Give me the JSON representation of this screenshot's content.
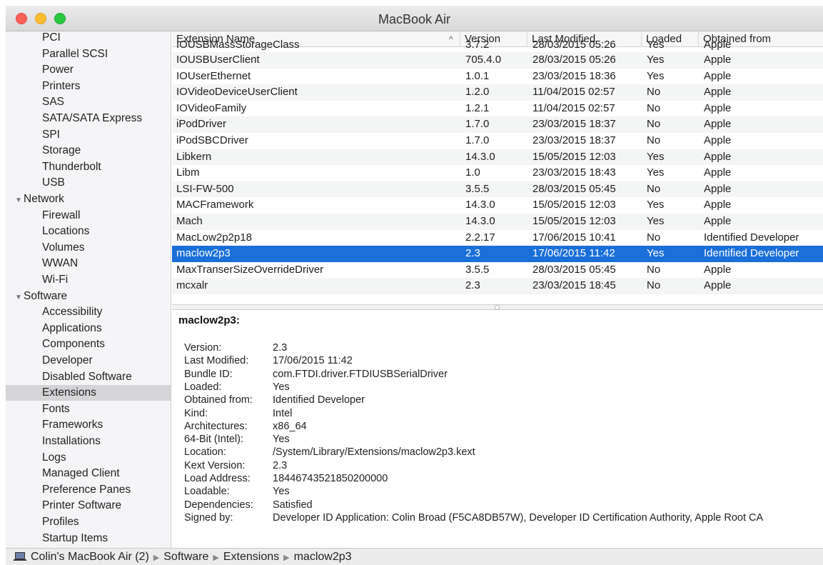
{
  "window": {
    "title": "MacBook Air"
  },
  "sidebar": {
    "items": [
      {
        "label": "PCI",
        "type": "child"
      },
      {
        "label": "Parallel SCSI",
        "type": "child"
      },
      {
        "label": "Power",
        "type": "child"
      },
      {
        "label": "Printers",
        "type": "child"
      },
      {
        "label": "SAS",
        "type": "child"
      },
      {
        "label": "SATA/SATA Express",
        "type": "child"
      },
      {
        "label": "SPI",
        "type": "child"
      },
      {
        "label": "Storage",
        "type": "child"
      },
      {
        "label": "Thunderbolt",
        "type": "child"
      },
      {
        "label": "USB",
        "type": "child"
      },
      {
        "label": "Network",
        "type": "section"
      },
      {
        "label": "Firewall",
        "type": "child"
      },
      {
        "label": "Locations",
        "type": "child"
      },
      {
        "label": "Volumes",
        "type": "child"
      },
      {
        "label": "WWAN",
        "type": "child"
      },
      {
        "label": "Wi-Fi",
        "type": "child"
      },
      {
        "label": "Software",
        "type": "section"
      },
      {
        "label": "Accessibility",
        "type": "child"
      },
      {
        "label": "Applications",
        "type": "child"
      },
      {
        "label": "Components",
        "type": "child"
      },
      {
        "label": "Developer",
        "type": "child"
      },
      {
        "label": "Disabled Software",
        "type": "child"
      },
      {
        "label": "Extensions",
        "type": "child",
        "selected": true
      },
      {
        "label": "Fonts",
        "type": "child"
      },
      {
        "label": "Frameworks",
        "type": "child"
      },
      {
        "label": "Installations",
        "type": "child"
      },
      {
        "label": "Logs",
        "type": "child"
      },
      {
        "label": "Managed Client",
        "type": "child"
      },
      {
        "label": "Preference Panes",
        "type": "child"
      },
      {
        "label": "Printer Software",
        "type": "child"
      },
      {
        "label": "Profiles",
        "type": "child"
      },
      {
        "label": "Startup Items",
        "type": "child"
      }
    ]
  },
  "table": {
    "columns": [
      "Extension Name",
      "Version",
      "Last Modified",
      "Loaded",
      "Obtained from"
    ],
    "sort_indicator": "^",
    "partial_row": [
      "IOUSBMassStorageClass",
      "3.7.2",
      "28/03/2015 05:26",
      "Yes",
      "Apple"
    ],
    "rows": [
      [
        "IOUSBUserClient",
        "705.4.0",
        "28/03/2015 05:26",
        "Yes",
        "Apple"
      ],
      [
        "IOUserEthernet",
        "1.0.1",
        "23/03/2015 18:36",
        "Yes",
        "Apple"
      ],
      [
        "IOVideoDeviceUserClient",
        "1.2.0",
        "11/04/2015 02:57",
        "No",
        "Apple"
      ],
      [
        "IOVideoFamily",
        "1.2.1",
        "11/04/2015 02:57",
        "No",
        "Apple"
      ],
      [
        "iPodDriver",
        "1.7.0",
        "23/03/2015 18:37",
        "No",
        "Apple"
      ],
      [
        "iPodSBCDriver",
        "1.7.0",
        "23/03/2015 18:37",
        "No",
        "Apple"
      ],
      [
        "Libkern",
        "14.3.0",
        "15/05/2015 12:03",
        "Yes",
        "Apple"
      ],
      [
        "Libm",
        "1.0",
        "23/03/2015 18:43",
        "Yes",
        "Apple"
      ],
      [
        "LSI-FW-500",
        "3.5.5",
        "28/03/2015 05:45",
        "No",
        "Apple"
      ],
      [
        "MACFramework",
        "14.3.0",
        "15/05/2015 12:03",
        "Yes",
        "Apple"
      ],
      [
        "Mach",
        "14.3.0",
        "15/05/2015 12:03",
        "Yes",
        "Apple"
      ],
      [
        "MacLow2p2p18",
        "2.2.17",
        "17/06/2015 10:41",
        "No",
        "Identified Developer"
      ],
      [
        "maclow2p3",
        "2.3",
        "17/06/2015 11:42",
        "Yes",
        "Identified Developer"
      ],
      [
        "MaxTranserSizeOverrideDriver",
        "3.5.5",
        "28/03/2015 05:45",
        "No",
        "Apple"
      ],
      [
        "mcxalr",
        "2.3",
        "23/03/2015 18:45",
        "No",
        "Apple"
      ]
    ],
    "selected_row": 12
  },
  "detail": {
    "title": "maclow2p3:",
    "fields": [
      {
        "key": "Version:",
        "value": "2.3"
      },
      {
        "key": "Last Modified:",
        "value": "17/06/2015 11:42"
      },
      {
        "key": "Bundle ID:",
        "value": "com.FTDI.driver.FTDIUSBSerialDriver"
      },
      {
        "key": "Loaded:",
        "value": "Yes"
      },
      {
        "key": "Obtained from:",
        "value": "Identified Developer"
      },
      {
        "key": "Kind:",
        "value": "Intel"
      },
      {
        "key": "Architectures:",
        "value": "x86_64"
      },
      {
        "key": "64-Bit (Intel):",
        "value": "Yes"
      },
      {
        "key": "Location:",
        "value": "/System/Library/Extensions/maclow2p3.kext"
      },
      {
        "key": "Kext Version:",
        "value": "2.3"
      },
      {
        "key": "Load Address:",
        "value": "18446743521850200000"
      },
      {
        "key": "Loadable:",
        "value": "Yes"
      },
      {
        "key": "Dependencies:",
        "value": "Satisfied"
      },
      {
        "key": "Signed by:",
        "value": "Developer ID Application: Colin Broad (F5CA8DB57W), Developer ID Certification Authority, Apple Root CA"
      }
    ]
  },
  "pathbar": {
    "icon": "laptop-icon",
    "crumbs": [
      "Colin's MacBook Air (2)",
      "Software",
      "Extensions",
      "maclow2p3"
    ]
  },
  "colors": {
    "selection": "#1a6fd9",
    "sidebar_selected": "#d5d5d8"
  }
}
